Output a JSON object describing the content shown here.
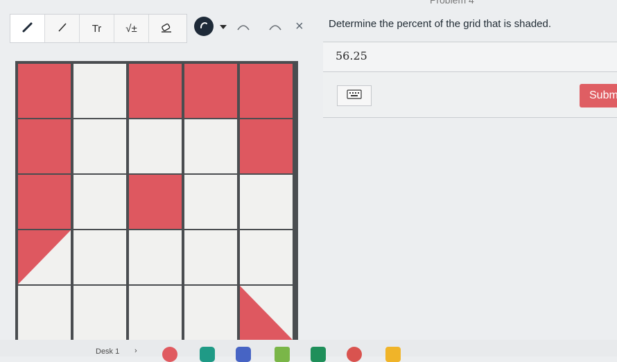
{
  "header": {
    "problem_label": "Problem 4"
  },
  "toolbar": {
    "tools": [
      {
        "name": "pen-tool",
        "glyph": ""
      },
      {
        "name": "line-tool",
        "glyph": ""
      },
      {
        "name": "text-tool",
        "glyph": "Tr"
      },
      {
        "name": "math-tool",
        "glyph": "√±"
      },
      {
        "name": "eraser-tool",
        "glyph": ""
      }
    ]
  },
  "question": {
    "text": "Determine the percent of the grid that is shaded."
  },
  "answer": {
    "value": "56.25"
  },
  "submit": {
    "label": "Subm"
  },
  "taskbar": {
    "desk_label": "Desk 1",
    "chevron": "›"
  },
  "colors": {
    "shaded": "#de5860",
    "unshaded": "#f1f1ef",
    "submit": "#df5e63"
  },
  "grid": {
    "rows": 5,
    "cols": 5,
    "cells": [
      [
        "shaded",
        "empty",
        "shaded",
        "shaded",
        "shaded"
      ],
      [
        "shaded",
        "empty",
        "empty",
        "empty",
        "shaded"
      ],
      [
        "shaded",
        "empty",
        "shaded",
        "empty",
        "empty"
      ],
      [
        "half-top-left",
        "empty",
        "empty",
        "empty",
        "empty"
      ],
      [
        "empty",
        "empty",
        "empty",
        "empty",
        "half-bottom-right"
      ]
    ]
  }
}
